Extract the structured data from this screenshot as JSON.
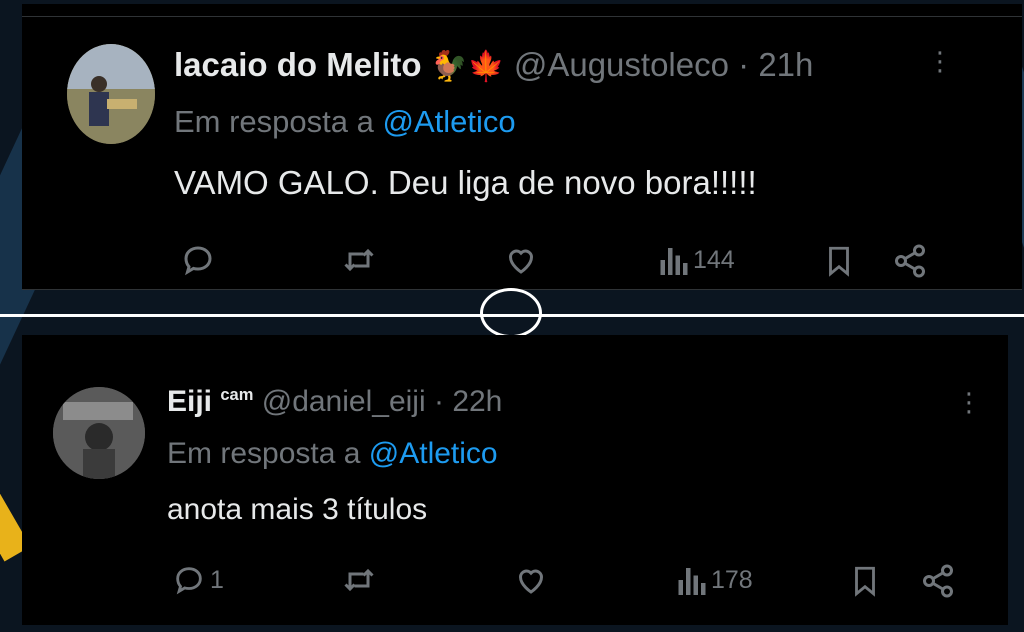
{
  "tweets": [
    {
      "name": "lacaio do Melito",
      "name_emoji": "🐓🍁",
      "handle": "@Augustoleco",
      "separator": "·",
      "time": "21h",
      "reply_prefix": "Em resposta a",
      "reply_to": "@Atletico",
      "text": "VAMO GALO. Deu liga de novo bora!!!!!",
      "replies": "",
      "views": "144",
      "more": "⋮"
    },
    {
      "name": "Eiji",
      "name_sup": "cam",
      "handle": "@daniel_eiji",
      "separator": "·",
      "time": "22h",
      "reply_prefix": "Em resposta a",
      "reply_to": "@Atletico",
      "text": "anota mais 3 títulos",
      "replies": "1",
      "views": "178",
      "more": "⋮"
    }
  ],
  "colors": {
    "background": "#000000",
    "primary_text": "#e7e9ea",
    "secondary_text": "#71767b",
    "link": "#1d9bf0"
  },
  "icons": [
    "reply-icon",
    "retweet-icon",
    "like-icon",
    "views-icon",
    "bookmark-icon",
    "share-icon",
    "more-icon"
  ]
}
